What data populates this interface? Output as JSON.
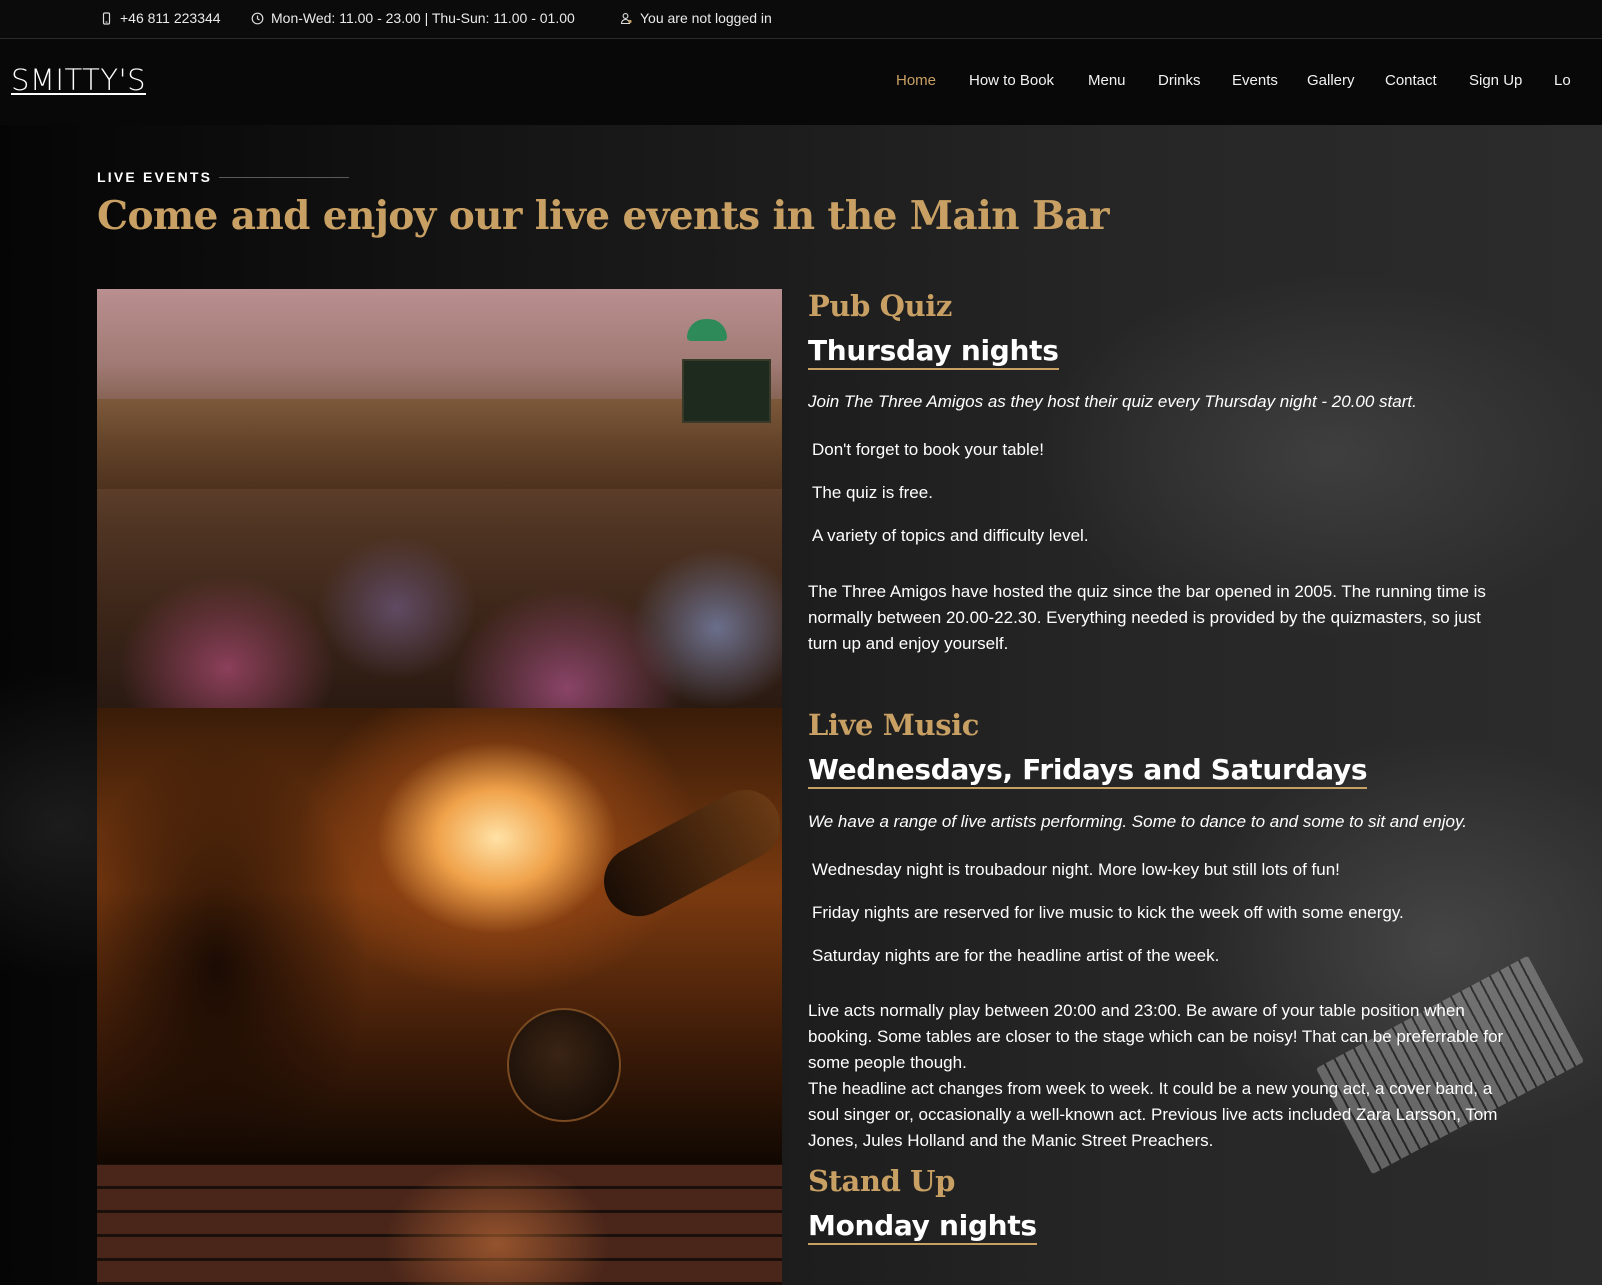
{
  "topbar": {
    "phone": "+46 811 223344",
    "hours": "Mon-Wed: 11.00 - 23.00 | Thu-Sun: 11.00 - 01.00",
    "login_status": "You are not logged in",
    "icons": [
      "phone-icon",
      "clock-icon",
      "user-icon"
    ]
  },
  "brand": {
    "logo": "SMITTY'S"
  },
  "nav": {
    "items": [
      {
        "label": "Home",
        "active": true
      },
      {
        "label": "How to Book"
      },
      {
        "label": "Menu"
      },
      {
        "label": "Drinks"
      },
      {
        "label": "Events"
      },
      {
        "label": "Gallery"
      },
      {
        "label": "Contact"
      },
      {
        "label": "Sign Up"
      },
      {
        "label": "Lo"
      }
    ]
  },
  "section": {
    "eyebrow": "LIVE EVENTS",
    "headline": "Come and enjoy our live events in the Main Bar"
  },
  "events": [
    {
      "title": "Pub Quiz",
      "subtitle": "Thursday nights",
      "intro": "Join The Three Amigos as they host their quiz every Thursday night - 20.00 start.",
      "bullets": [
        "Don't forget to book your table!",
        "The quiz is free.",
        "A variety of topics and difficulty level."
      ],
      "paragraph": "The Three Amigos have hosted the quiz since the bar opened in 2005. The running time is normally between 20.00-22.30. Everything needed is provided by the quizmasters, so just turn up and enjoy yourself."
    },
    {
      "title": "Live Music",
      "subtitle": "Wednesdays, Fridays and Saturdays",
      "intro": "We have a range of live artists performing. Some to dance to and some to sit and enjoy.",
      "bullets": [
        "Wednesday night is troubadour night. More low-key but still lots of fun!",
        "Friday nights are reserved for live music to kick the week off with some energy.",
        "Saturday nights are for the headline artist of the week."
      ],
      "paragraph": "Live acts normally play between 20:00 and 23:00. Be aware of your table position when booking. Some tables are closer to the stage which can be noisy! That can be preferrable for some people though.",
      "paragraph2": "The headline act changes from week to week. It could be a new young act, a cover band, a soul singer or, occasionally a well-known act. Previous live acts included Zara Larsson, Tom Jones, Jules Holland and the Manic Street Preachers."
    },
    {
      "title": "Stand Up",
      "subtitle": "Monday nights"
    }
  ],
  "colors": {
    "accent": "#c9a063",
    "background": "#0c0c0c",
    "text": "#ffffff"
  }
}
